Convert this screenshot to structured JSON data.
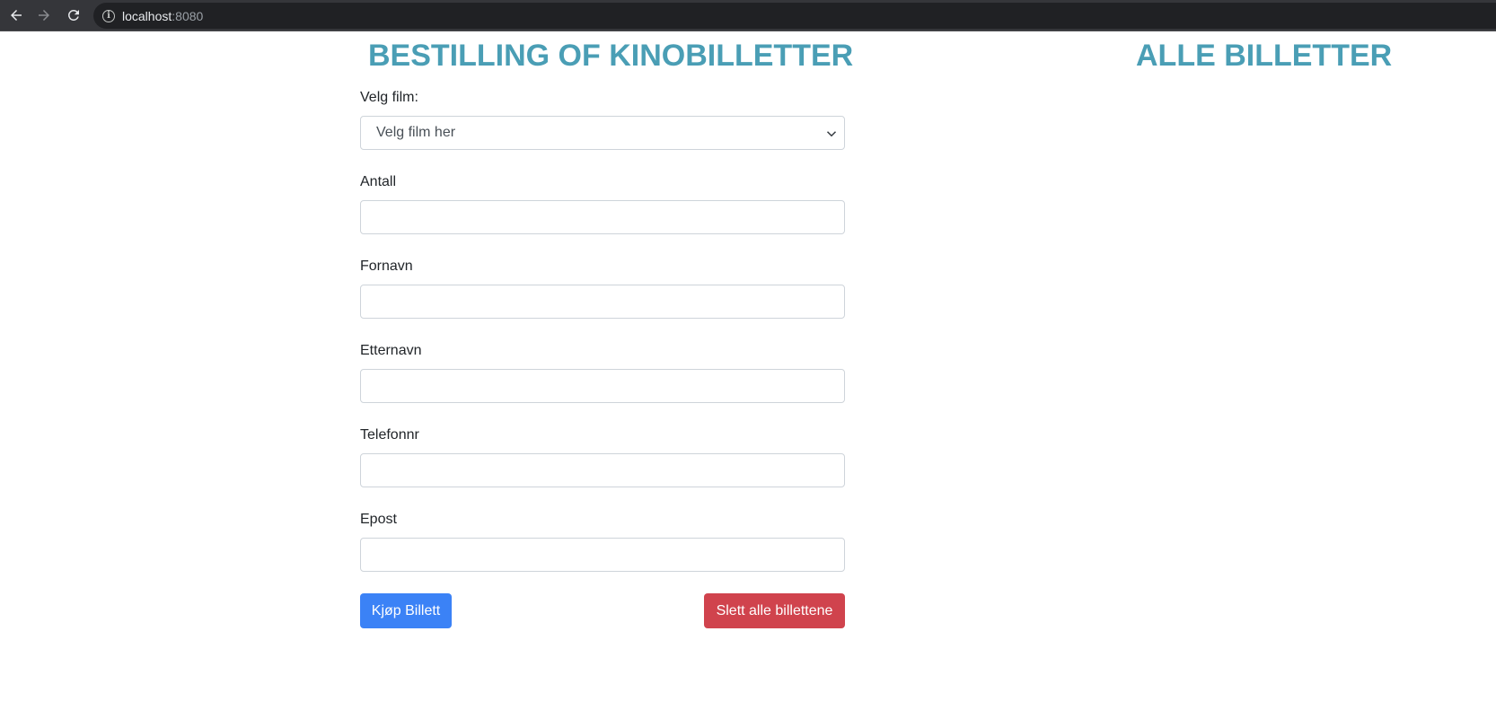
{
  "browser": {
    "url_host": "localhost",
    "url_port": ":8080"
  },
  "order_heading": "BESTILLING OF KINOBILLETTER",
  "tickets_heading": "ALLE BILLETTER",
  "form": {
    "film_label": "Velg film:",
    "film_selected": "Velg film her",
    "antall_label": "Antall",
    "antall_value": "",
    "fornavn_label": "Fornavn",
    "fornavn_value": "",
    "etternavn_label": "Etternavn",
    "etternavn_value": "",
    "telefon_label": "Telefonnr",
    "telefon_value": "",
    "epost_label": "Epost",
    "epost_value": ""
  },
  "buttons": {
    "buy_label": "Kjøp Billett",
    "delete_label": "Slett alle billettene"
  },
  "colors": {
    "heading": "#4a9eb5",
    "buy_button": "#3b82f6",
    "delete_button": "#d0434d",
    "browser_bar": "#35363a"
  }
}
